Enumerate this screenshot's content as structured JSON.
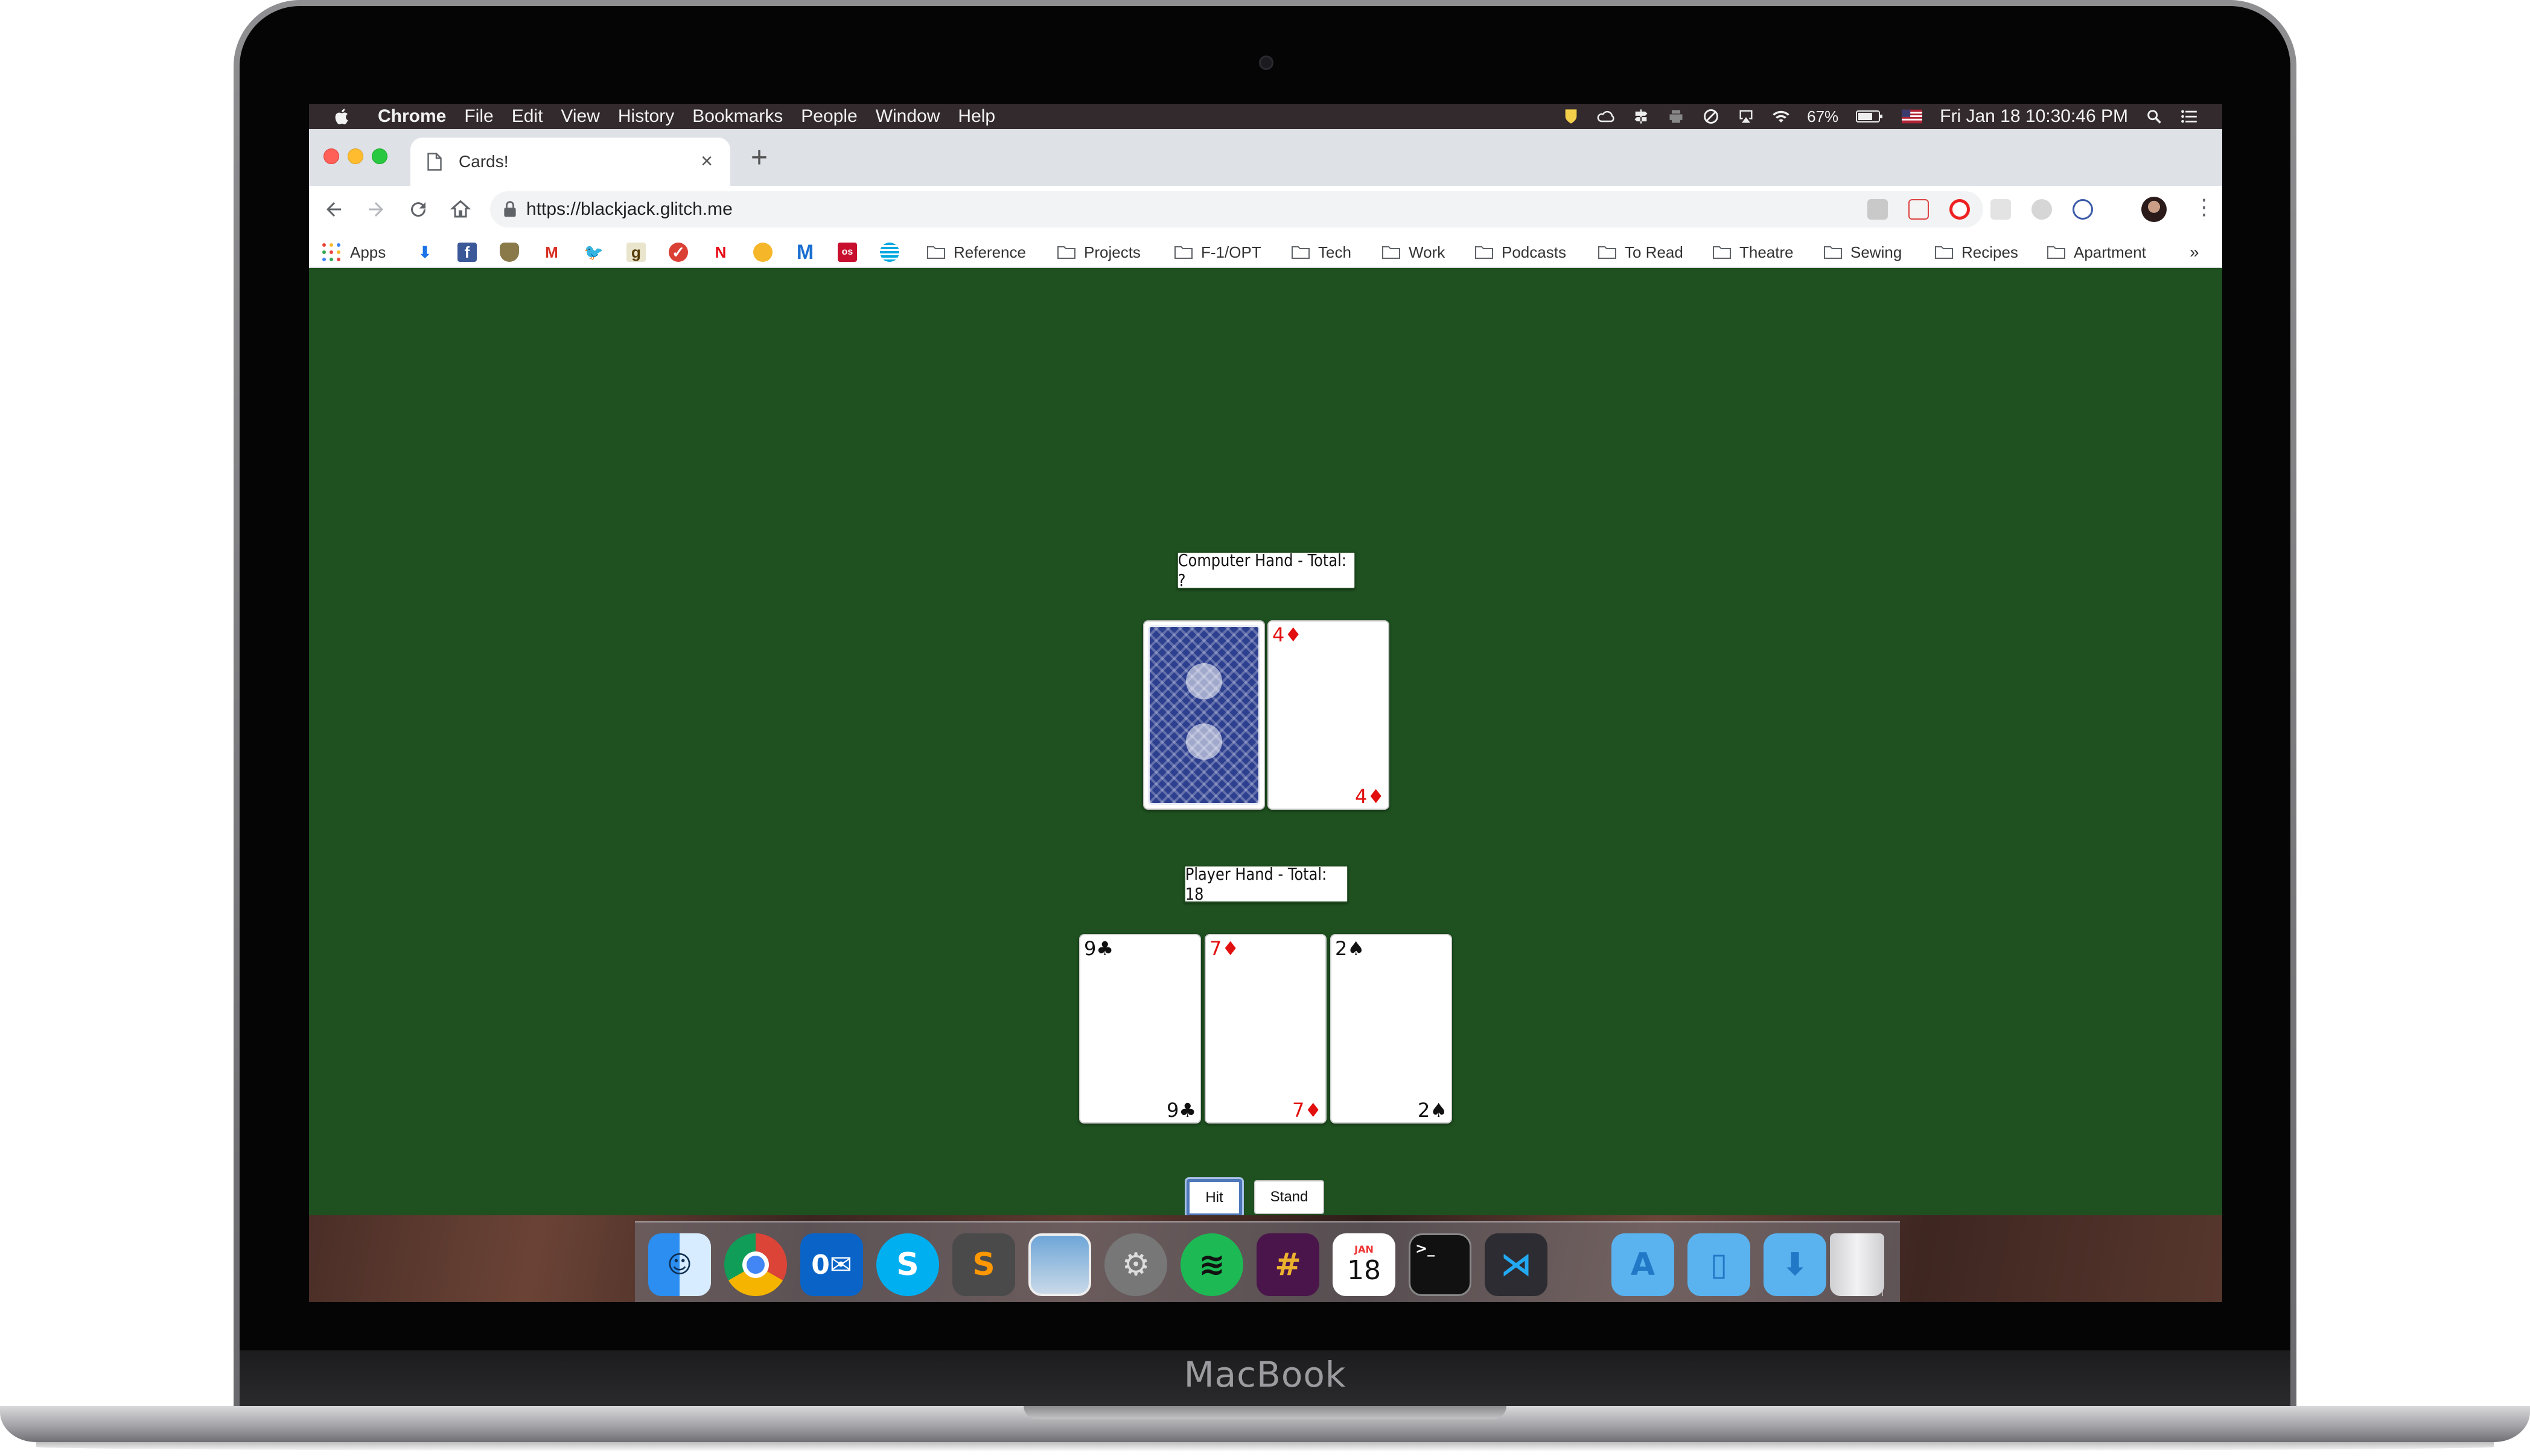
{
  "device": {
    "brand": "MacBook"
  },
  "menubar": {
    "app_name": "Chrome",
    "items": [
      "File",
      "Edit",
      "View",
      "History",
      "Bookmarks",
      "People",
      "Window",
      "Help"
    ],
    "battery": "67%",
    "datetime": "Fri Jan 18  10:30:46 PM",
    "status_icons": [
      "norton-icon",
      "creative-cloud-icon",
      "dropbox-ish-icon",
      "printer-icon",
      "block-icon",
      "airplay-icon",
      "wifi-icon",
      "battery-icon",
      "flag-us-icon",
      "spotlight-search-icon",
      "notification-center-icon"
    ]
  },
  "browser": {
    "tab_title": "Cards!",
    "new_tab_symbol": "+",
    "close_tab_symbol": "×",
    "url": "https://blackjack.glitch.me",
    "bookmarks": {
      "apps_label": "Apps",
      "favicons": [
        "download-icon",
        "facebook-icon",
        "shield-icon",
        "gmail-icon",
        "twitter-icon",
        "goodreads-icon",
        "todo-icon",
        "netflix-icon",
        "coin-icon",
        "medium-icon",
        "lastpass-icon",
        "att-icon"
      ],
      "folders": [
        "Reference",
        "Projects",
        "F-1/OPT",
        "Tech",
        "Work",
        "Podcasts",
        "To Read",
        "Theatre",
        "Sewing",
        "Recipes",
        "Apartment"
      ],
      "overflow": "»"
    }
  },
  "game": {
    "computer_label": "Computer Hand - Total: ?",
    "player_label": "Player Hand - Total: 18",
    "computer_cards": [
      {
        "face_down": true
      },
      {
        "rank": "4",
        "suit": "♦",
        "color": "red"
      }
    ],
    "player_cards": [
      {
        "rank": "9",
        "suit": "♣",
        "color": "black"
      },
      {
        "rank": "7",
        "suit": "♦",
        "color": "red"
      },
      {
        "rank": "2",
        "suit": "♠",
        "color": "black"
      }
    ],
    "hit_label": "Hit",
    "stand_label": "Stand",
    "table_color": "#1e5020"
  },
  "dock": {
    "calendar_month": "JAN",
    "calendar_day": "18",
    "apps": [
      "finder-icon",
      "chrome-icon",
      "outlook-icon",
      "skype-icon",
      "sublime-icon",
      "preview-icon",
      "system-preferences-icon",
      "spotify-icon",
      "slack-icon",
      "calendar-icon",
      "terminal-icon",
      "vscode-icon",
      "applications-folder-icon",
      "documents-folder-icon",
      "downloads-folder-icon",
      "trash-icon"
    ]
  }
}
